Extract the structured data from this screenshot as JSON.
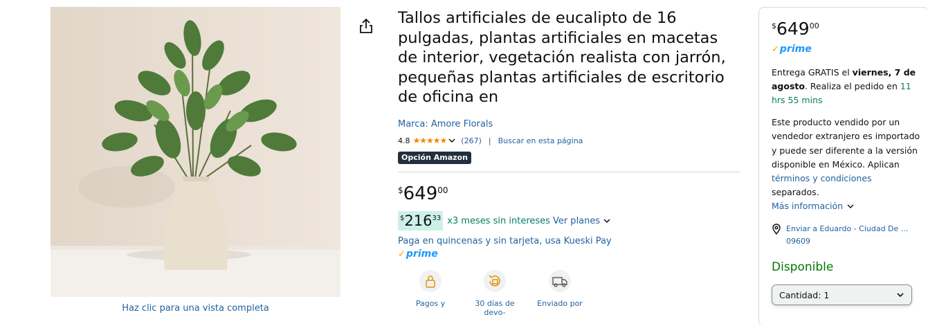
{
  "product": {
    "image_caption": "Haz clic para una vista completa",
    "title": "Tallos artificiales de eucalipto de 16 pulgadas, plantas artificiales en macetas de interior, vegetación realista con jarrón, pequeñas plantas artificiales de escritorio de oficina en",
    "brand": "Marca: Amore Florals",
    "rating": "4.8",
    "stars": "★★★★★",
    "review_count": "(267)",
    "search_page": "Buscar en esta página",
    "badge": "Opción Amazon"
  },
  "price": {
    "symbol": "$",
    "whole": "649",
    "cents": "00"
  },
  "installment": {
    "symbol": "$",
    "whole": "216",
    "cents": "33",
    "text": "x3 meses sin intereses",
    "link": "Ver planes",
    "kueski": "Paga en quincenas y sin tarjeta, usa Kueski Pay"
  },
  "prime_label": "prime",
  "features": [
    {
      "label": "Pagos y",
      "icon": "secure-payment-icon"
    },
    {
      "label": "30 días de devo-",
      "icon": "returns-icon"
    },
    {
      "label": "Enviado por",
      "icon": "delivery-truck-icon"
    }
  ],
  "buybox": {
    "price_symbol": "$",
    "price_whole": "649",
    "price_cents": "00",
    "delivery_prefix": "Entrega GRATIS el ",
    "delivery_date": "viernes, 7 de agosto",
    "delivery_mid": ". Realiza el pedido en ",
    "delivery_time": "11 hrs 55 mins",
    "notice_text": "Este producto vendido por un vendedor extranjero es importado y puede ser diferente a la versión disponible en México. Aplican ",
    "notice_link": "términos y condiciones",
    "notice_end": " separados.",
    "more_info": "Más información",
    "location_line1": "Enviar a Eduardo - Ciudad De ...",
    "location_line2": "09609",
    "availability": "Disponible",
    "quantity_label": "Cantidad:",
    "quantity_value": "1"
  },
  "colors": {
    "link": "#2162a1",
    "green": "#067d62",
    "available": "#007600",
    "star": "#f08804",
    "prime_blue": "#1a98ff"
  }
}
